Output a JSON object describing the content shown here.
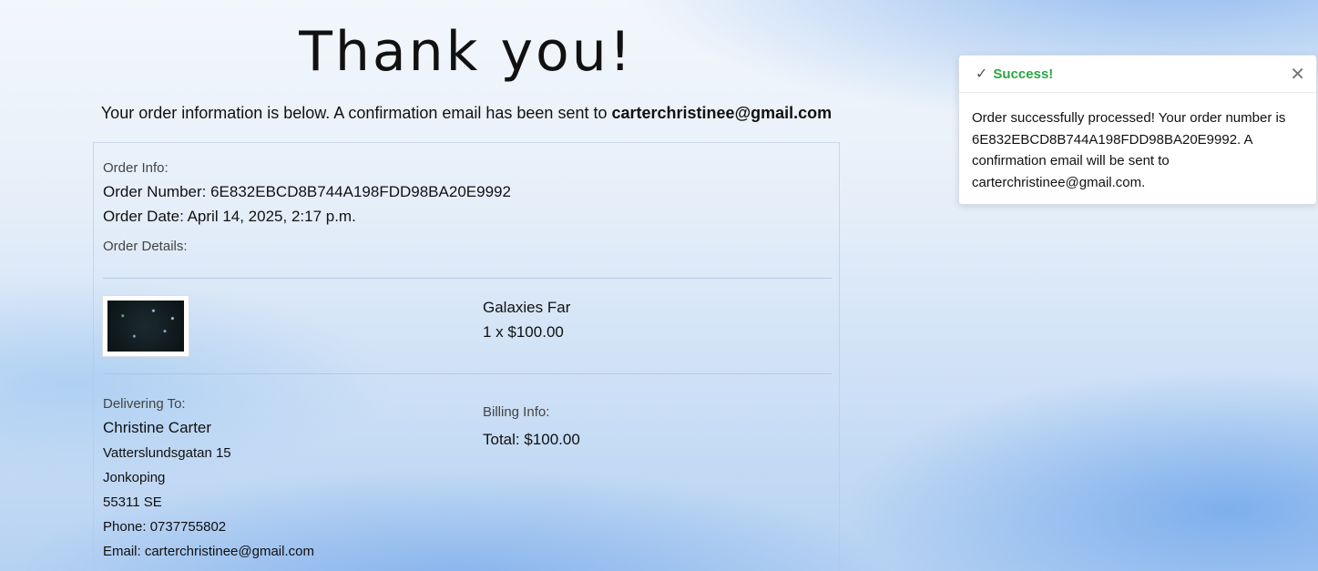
{
  "header": {
    "title": "Thank you!",
    "subtitle_text": "Your order information is below. A confirmation email has been sent to",
    "subtitle_email": "carterchristinee@gmail.com"
  },
  "order": {
    "info_label": "Order Info:",
    "number_text": "Order Number: 6E832EBCD8B744A198FDD98BA20E9992",
    "date_text": "Order Date: April 14, 2025, 2:17 p.m.",
    "details_label": "Order Details:"
  },
  "item": {
    "image_alt": "Galaxies Far",
    "name": "Galaxies Far",
    "qty_price": "1 x $100.00"
  },
  "delivery": {
    "label": "Delivering To:",
    "name": "Christine Carter",
    "street": "Vatterslundsgatan 15",
    "city": "Jonkoping",
    "postcode_country": "55311 SE",
    "phone": "Phone: 0737755802",
    "email": "Email: carterchristinee@gmail.com"
  },
  "billing": {
    "label": "Billing Info:",
    "total": "Total: $100.00"
  },
  "toast": {
    "title": "Success!",
    "check_icon": "✓",
    "close_icon": "✕",
    "message": "Order successfully processed! Your order number is 6E832EBCD8B744A198FDD98BA20E9992. A confirmation email will be sent to carterchristinee@gmail.com.",
    "title_color": "#28a745"
  }
}
